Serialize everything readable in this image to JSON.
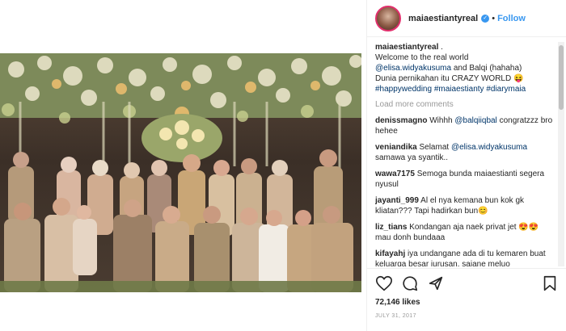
{
  "post": {
    "username": "maiaestiantyreal",
    "separator": "•",
    "follow_label": "Follow",
    "verified_icon": "verified-badge-icon"
  },
  "caption": {
    "username": "maiaestiantyreal",
    "line1": " .",
    "line2": "Welcome to the real world",
    "mention1": "@elisa.widyakusuma",
    "line3_mid": " and Balqi (hahaha)",
    "line4": "Dunia pernikahan itu CRAZY WORLD 😝",
    "hashtags": "#happywedding #maiaestianty #diarymaia"
  },
  "load_more_label": "Load more comments",
  "comments": [
    {
      "user": "denissmagno",
      "text": " Wihhh ",
      "mention": "@balqiiqbal",
      "text2": " congratzzz bro hehee"
    },
    {
      "user": "veniandika",
      "text": " Selamat ",
      "mention": "@elisa.widyakusuma",
      "text2": " samawa ya syantik.."
    },
    {
      "user": "wawa7175",
      "text": " Semoga bunda maiaestianti segera nyusul",
      "mention": "",
      "text2": ""
    },
    {
      "user": "jayanti_999",
      "text": " Al el nya kemana bun kok gk kliatan??? Tapi hadirkan bun😊",
      "mention": "",
      "text2": ""
    },
    {
      "user": "liz_tians",
      "text": " Kondangan aja naek privat jet 😍😍 mau donh bundaaa",
      "mention": "",
      "text2": ""
    },
    {
      "user": "kifayahj",
      "text": " iya undangane ada di tu kemaren buat keluarga besar jurusan. sajane meluo",
      "mention": "",
      "text2": ""
    }
  ],
  "likes": "72,146 likes",
  "date": "JULY 31, 2017",
  "icons": {
    "like": "heart-icon",
    "comment": "comment-icon",
    "share": "share-icon",
    "save": "bookmark-icon"
  },
  "colors": {
    "link": "#003569",
    "follow": "#3897f0",
    "muted": "#999999",
    "text": "#262626"
  }
}
